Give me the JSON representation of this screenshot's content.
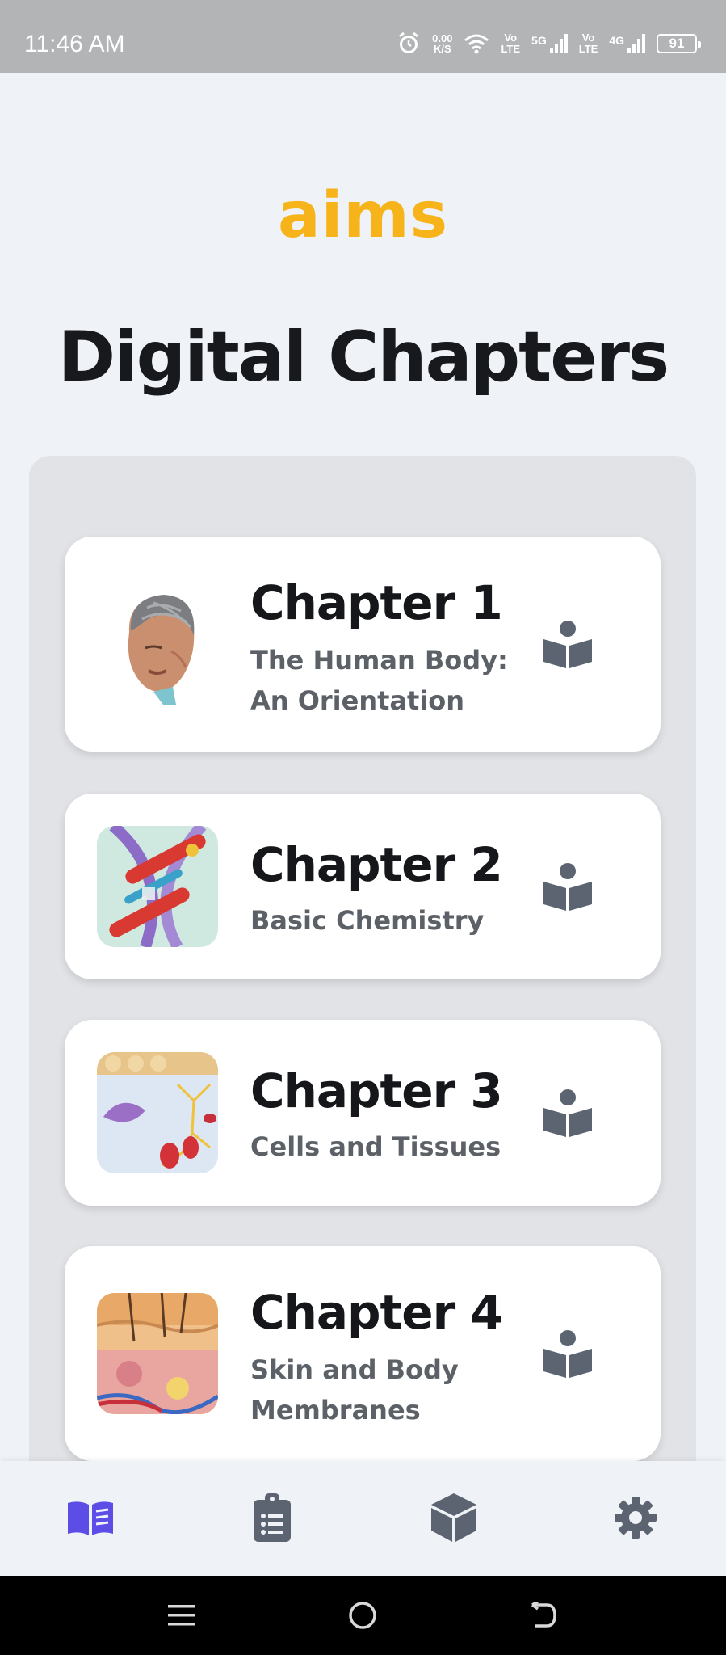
{
  "status_bar": {
    "time": "11:46 AM",
    "net_speed_value": "0.00",
    "net_speed_unit": "K/S",
    "sim1_top": "Vo",
    "sim1_bottom": "LTE",
    "sim1_network": "5G",
    "sim2_top": "Vo",
    "sim2_bottom": "LTE",
    "sim2_network": "4G",
    "battery": "91"
  },
  "header": {
    "brand": "aims",
    "title": "Digital Chapters"
  },
  "chapters": [
    {
      "title": "Chapter 1",
      "subtitle": "The Human Body:\n An Orientation",
      "icon": "head-anatomy-thumbnail"
    },
    {
      "title": "Chapter 2",
      "subtitle": "Basic Chemistry",
      "icon": "dna-thumbnail"
    },
    {
      "title": "Chapter 3",
      "subtitle": "Cells and Tissues",
      "icon": "cells-thumbnail"
    },
    {
      "title": "Chapter 4",
      "subtitle": "Skin and Body\nMembranes",
      "icon": "skin-layers-thumbnail"
    }
  ],
  "colors": {
    "brand": "#f6b31a",
    "active_nav": "#5b4de6",
    "icon_gray": "#5b6470"
  },
  "bottom_nav": [
    {
      "icon": "open-book-icon",
      "active": true
    },
    {
      "icon": "clipboard-list-icon",
      "active": false
    },
    {
      "icon": "cube-icon",
      "active": false
    },
    {
      "icon": "gear-icon",
      "active": false
    }
  ]
}
